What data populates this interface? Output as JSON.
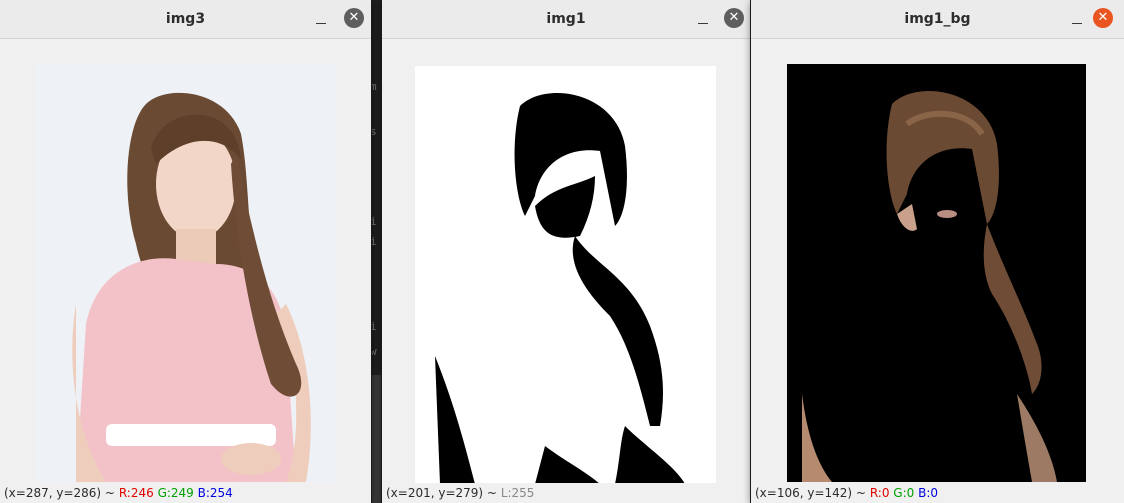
{
  "windows": [
    {
      "title": "img3",
      "status": {
        "coords": "(x=287, y=286) ~",
        "r": "R:246",
        "g": "G:249",
        "b": "B:254"
      }
    },
    {
      "title": "img1",
      "status": {
        "coords": "(x=201, y=279) ~",
        "l": "L:255"
      }
    },
    {
      "title": "img1_bg",
      "status": {
        "coords": "(x=106, y=142) ~",
        "r": "R:0",
        "g": "G:0",
        "b": "B:0"
      }
    }
  ],
  "icons": {
    "minimize": "minimize-icon",
    "close": "close-icon"
  },
  "colors": {
    "close_active": "#e95420",
    "close_inactive": "#5e5e5e"
  }
}
